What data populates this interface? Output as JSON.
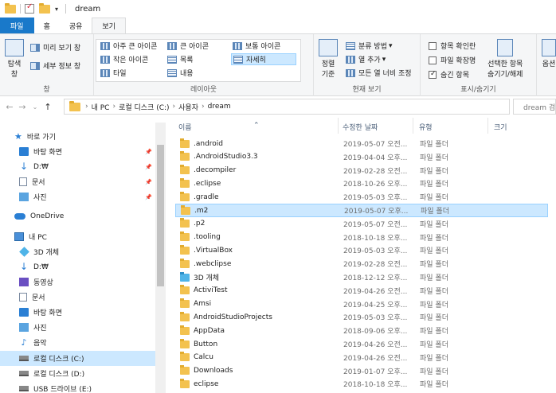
{
  "window": {
    "title": "dream"
  },
  "ribbon_tabs": [
    "파일",
    "홈",
    "공유",
    "보기"
  ],
  "ribbon": {
    "pane": {
      "nav_pane_line1": "탐색",
      "nav_pane_line2": "창",
      "preview": "미리 보기 창",
      "details_pane": "세부 정보 창",
      "group_label": "창"
    },
    "layout": {
      "items": [
        "아주 큰 아이콘",
        "큰 아이콘",
        "보통 아이콘",
        "작은 아이콘",
        "목록",
        "자세히",
        "타일",
        "내용"
      ],
      "selected": "자세히",
      "group_label": "레이아웃"
    },
    "current_view": {
      "sort_line1": "정렬",
      "sort_line2": "기준",
      "group_by": "분류 방법",
      "add_columns": "열 추가",
      "fit_columns": "모든 열 너비 조정",
      "group_label": "현재 보기"
    },
    "show_hide": {
      "item_checkboxes": "항목 확인란",
      "file_extensions": "파일 확장명",
      "hidden_items": "숨긴 항목",
      "hide_selected_line1": "선택한 항목",
      "hide_selected_line2": "숨기기/해제",
      "group_label": "표시/숨기기"
    },
    "options": "옵션"
  },
  "address": {
    "crumbs": [
      "내 PC",
      "로컬 디스크 (C:)",
      "사용자",
      "dream"
    ],
    "search_placeholder": "dream 검색"
  },
  "nav_pane": {
    "items": [
      {
        "label": "바로 가기",
        "icon": "star-icon"
      },
      {
        "label": "바탕 화면",
        "icon": "desktop-icon",
        "pinned": true
      },
      {
        "label": "D:₩",
        "icon": "download-icon",
        "pinned": true
      },
      {
        "label": "문서",
        "icon": "document-icon",
        "pinned": true
      },
      {
        "label": "사진",
        "icon": "picture-icon",
        "pinned": true
      },
      {
        "label": "OneDrive",
        "icon": "cloud-icon"
      },
      {
        "label": "내 PC",
        "icon": "pc-icon"
      },
      {
        "label": "3D 개체",
        "icon": "cube-icon"
      },
      {
        "label": "D:₩",
        "icon": "download-icon"
      },
      {
        "label": "동영상",
        "icon": "video-icon"
      },
      {
        "label": "문서",
        "icon": "document-icon"
      },
      {
        "label": "바탕 화면",
        "icon": "desktop-icon"
      },
      {
        "label": "사진",
        "icon": "picture-icon"
      },
      {
        "label": "음악",
        "icon": "music-icon"
      },
      {
        "label": "로컬 디스크 (C:)",
        "icon": "drive-icon",
        "selected": true
      },
      {
        "label": "로컬 디스크 (D:)",
        "icon": "drive-icon"
      },
      {
        "label": "USB 드라이브 (E:)",
        "icon": "drive-icon"
      }
    ]
  },
  "file_list": {
    "columns": [
      "이름",
      "수정한 날짜",
      "유형",
      "크기"
    ],
    "rows": [
      {
        "name": ".android",
        "date": "2019-05-07 오전...",
        "type": "파일 폴더"
      },
      {
        "name": ".AndroidStudio3.3",
        "date": "2019-04-04 오후...",
        "type": "파일 폴더"
      },
      {
        "name": ".decompiler",
        "date": "2019-02-28 오전...",
        "type": "파일 폴더"
      },
      {
        "name": ".eclipse",
        "date": "2018-10-26 오후...",
        "type": "파일 폴더"
      },
      {
        "name": ".gradle",
        "date": "2019-05-03 오후...",
        "type": "파일 폴더"
      },
      {
        "name": ".m2",
        "date": "2019-05-07 오후...",
        "type": "파일 폴더",
        "selected": true
      },
      {
        "name": ".p2",
        "date": "2019-05-07 오전...",
        "type": "파일 폴더"
      },
      {
        "name": ".tooling",
        "date": "2018-10-18 오후...",
        "type": "파일 폴더"
      },
      {
        "name": ".VirtualBox",
        "date": "2019-05-03 오후...",
        "type": "파일 폴더"
      },
      {
        "name": ".webclipse",
        "date": "2019-02-28 오전...",
        "type": "파일 폴더"
      },
      {
        "name": "3D 개체",
        "date": "2018-12-12 오후...",
        "type": "파일 폴더",
        "icon": "3d"
      },
      {
        "name": "ActiviTest",
        "date": "2019-04-26 오전...",
        "type": "파일 폴더"
      },
      {
        "name": "Amsi",
        "date": "2019-04-25 오후...",
        "type": "파일 폴더"
      },
      {
        "name": "AndroidStudioProjects",
        "date": "2019-05-03 오후...",
        "type": "파일 폴더"
      },
      {
        "name": "AppData",
        "date": "2018-09-06 오후...",
        "type": "파일 폴더"
      },
      {
        "name": "Button",
        "date": "2019-04-26 오전...",
        "type": "파일 폴더"
      },
      {
        "name": "Calcu",
        "date": "2019-04-26 오전...",
        "type": "파일 폴더"
      },
      {
        "name": "Downloads",
        "date": "2019-01-07 오후...",
        "type": "파일 폴더"
      },
      {
        "name": "eclipse",
        "date": "2018-10-18 오후...",
        "type": "파일 폴더"
      }
    ]
  }
}
